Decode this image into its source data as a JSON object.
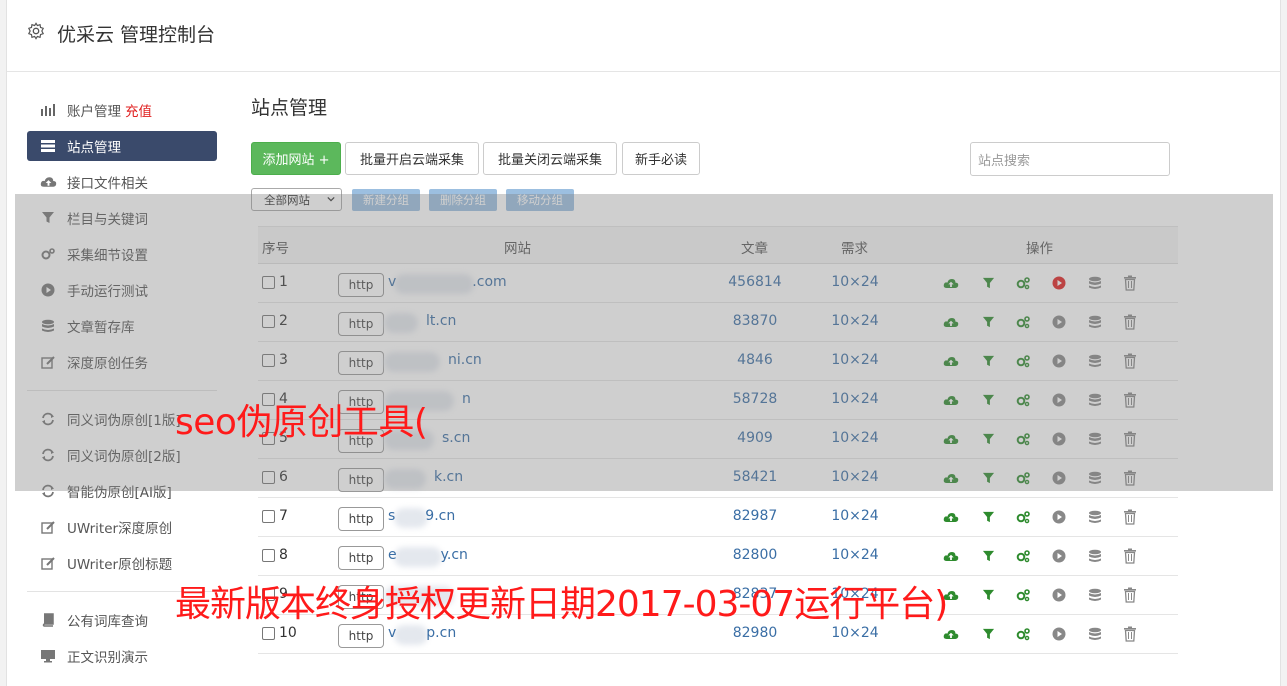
{
  "header": {
    "title": "优采云 管理控制台"
  },
  "sidebar": {
    "items": [
      {
        "label": "账户管理",
        "extra": "充值",
        "icon": "bar-chart-icon"
      },
      {
        "label": "站点管理",
        "icon": "server-icon",
        "active": true
      },
      {
        "label": "接口文件相关",
        "icon": "cloud-upload-icon"
      },
      {
        "label": "栏目与关键词",
        "icon": "filter-icon"
      },
      {
        "label": "采集细节设置",
        "icon": "cogs-icon"
      },
      {
        "label": "手动运行测试",
        "icon": "play-circle-icon"
      },
      {
        "label": "文章暂存库",
        "icon": "database-icon"
      },
      {
        "label": "深度原创任务",
        "icon": "edit-icon"
      },
      {
        "label": "同义词伪原创[1版]",
        "icon": "refresh-icon"
      },
      {
        "label": "同义词伪原创[2版]",
        "icon": "refresh-icon"
      },
      {
        "label": "智能伪原创[AI版]",
        "icon": "refresh-icon"
      },
      {
        "label": "UWriter深度原创",
        "icon": "edit-icon"
      },
      {
        "label": "UWriter原创标题",
        "icon": "edit-icon"
      },
      {
        "label": "公有词库查询",
        "icon": "book-icon"
      },
      {
        "label": "正文识别演示",
        "icon": "monitor-icon"
      }
    ]
  },
  "main": {
    "title": "站点管理",
    "toolbar": {
      "add_site": "添加网站 +",
      "batch_enable": "批量开启云端采集",
      "batch_disable": "批量关闭云端采集",
      "newbie": "新手必读",
      "search_placeholder": "站点搜索"
    },
    "group": {
      "select_value": "全部网站",
      "new_group": "新建分组",
      "delete_group": "删除分组",
      "move_group": "移动分组"
    },
    "table": {
      "headers": {
        "id": "序号",
        "site": "网站",
        "articles": "文章",
        "demand": "需求",
        "ops": "操作"
      },
      "http_label": "http",
      "rows": [
        {
          "id": "1",
          "site_prefix": "v",
          "site_suffix": ".com",
          "articles": "456814",
          "demand": "10×24",
          "running": true
        },
        {
          "id": "2",
          "site_prefix": "",
          "site_suffix": "lt.cn",
          "articles": "83870",
          "demand": "10×24",
          "running": false
        },
        {
          "id": "3",
          "site_prefix": "",
          "site_suffix": "ni.cn",
          "articles": "4846",
          "demand": "10×24",
          "running": false
        },
        {
          "id": "4",
          "site_prefix": "",
          "site_suffix": "n",
          "articles": "58728",
          "demand": "10×24",
          "running": false
        },
        {
          "id": "5",
          "site_prefix": "",
          "site_suffix": "s.cn",
          "articles": "4909",
          "demand": "10×24",
          "running": false
        },
        {
          "id": "6",
          "site_prefix": "",
          "site_suffix": "k.cn",
          "articles": "58421",
          "demand": "10×24",
          "running": false
        },
        {
          "id": "7",
          "site_prefix": "s",
          "site_suffix": "9.cn",
          "articles": "82987",
          "demand": "10×24",
          "running": false
        },
        {
          "id": "8",
          "site_prefix": "e",
          "site_suffix": "y.cn",
          "articles": "82800",
          "demand": "10×24",
          "running": false
        },
        {
          "id": "9",
          "site_prefix": "",
          "site_suffix": "",
          "articles": "82837",
          "demand": "10×24",
          "running": false
        },
        {
          "id": "10",
          "site_prefix": "v",
          "site_suffix": "p.cn",
          "articles": "82980",
          "demand": "10×24",
          "running": false
        }
      ]
    }
  },
  "watermark": {
    "line1": "seo伪原创工具(",
    "line2": "最新版本终身授权更新日期2017-03-07运行平台)"
  },
  "colors": {
    "sidebar_active": "#3a4a6b",
    "add_button": "#5cb85c",
    "group_buttons": "#9cbfe0",
    "link": "#3a6ea5",
    "watermark": "#ff1a1a",
    "run_active": "#e02020",
    "icon_green": "#2e8b2e"
  }
}
